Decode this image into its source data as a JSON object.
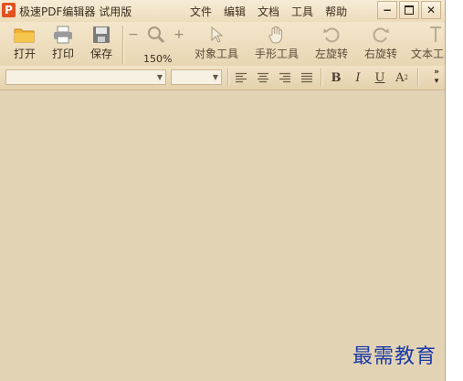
{
  "app": {
    "logo_letter": "P",
    "title": "极速PDF编辑器 试用版"
  },
  "menu": [
    "文件",
    "编辑",
    "文档",
    "工具",
    "帮助"
  ],
  "window_controls": {
    "minimize": "−",
    "maximize": "□",
    "close": "✕"
  },
  "toolbar": {
    "open": "打开",
    "print": "打印",
    "save": "保存",
    "zoom_out": "−",
    "zoom_in": "+",
    "zoom_level": "150%",
    "object_tool": "对象工具",
    "hand_tool": "手形工具",
    "rotate_left": "左旋转",
    "rotate_right": "右旋转",
    "text_tool": "文本工具"
  },
  "format_bar": {
    "bold": "B",
    "italic": "I",
    "underline": "U",
    "superscript": "A",
    "superscript_mark": "2",
    "more": "»"
  },
  "watermark": "最需教育",
  "colors": {
    "accent": "#e0531f",
    "workspace": "#e2d3b5",
    "watermark": "#1a3aa5"
  }
}
